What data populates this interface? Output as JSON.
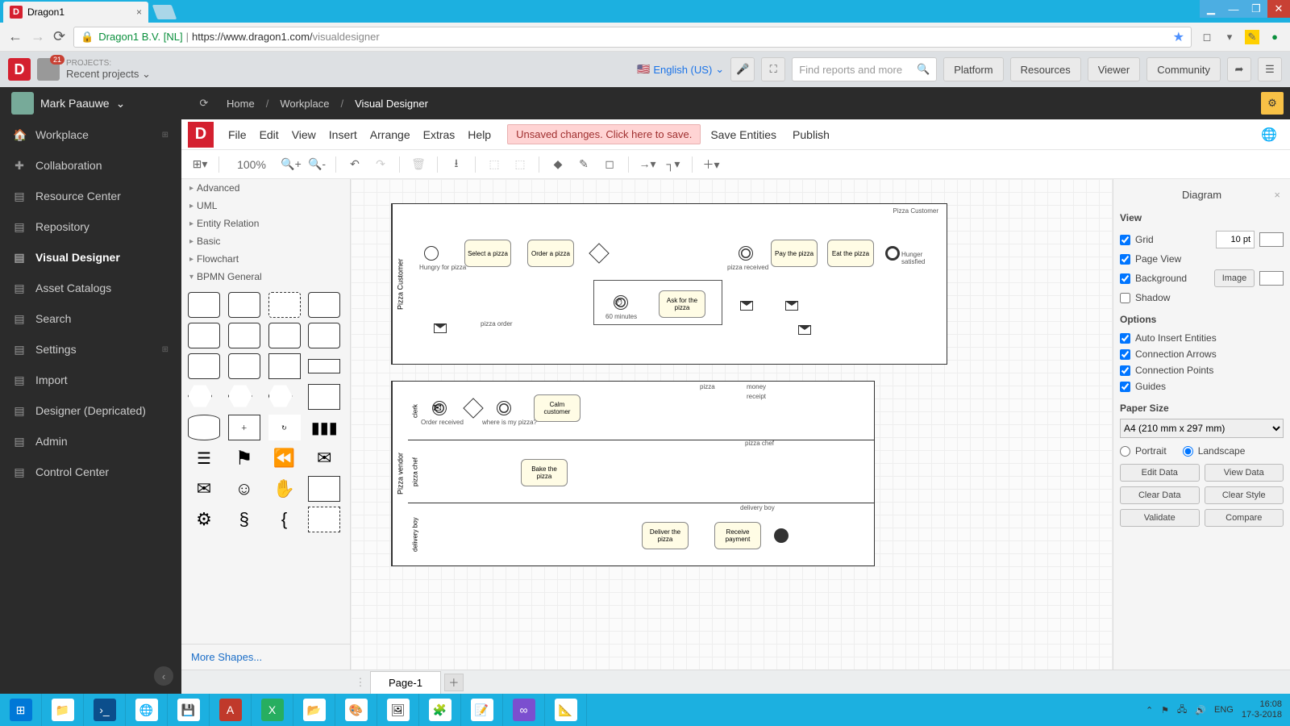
{
  "browser": {
    "tab_title": "Dragon1",
    "address_host": "Dragon1 B.V. [NL]",
    "address_sep": " | ",
    "address_url_base": "https://www.dragon1.com/",
    "address_url_path": "visualdesigner"
  },
  "win": {
    "min": "—",
    "max": "❐",
    "close": "✕"
  },
  "header": {
    "badge": "21",
    "projects_label": "PROJECTS:",
    "recent": "Recent projects",
    "language": "English (US)",
    "search_placeholder": "Find reports and more",
    "buttons": {
      "platform": "Platform",
      "resources": "Resources",
      "viewer": "Viewer",
      "community": "Community"
    }
  },
  "userbar": {
    "name": "Mark Paauwe",
    "crumbs": [
      "Home",
      "Workplace",
      "Visual Designer"
    ]
  },
  "leftnav": [
    {
      "label": "Workplace",
      "icon": "🏠",
      "exp": true
    },
    {
      "label": "Collaboration",
      "icon": "✚"
    },
    {
      "label": "Resource Center",
      "icon": "▤"
    },
    {
      "label": "Repository",
      "icon": "▤"
    },
    {
      "label": "Visual Designer",
      "icon": "▤",
      "active": true
    },
    {
      "label": "Asset Catalogs",
      "icon": "▤"
    },
    {
      "label": "Search",
      "icon": "▤"
    },
    {
      "label": "Settings",
      "icon": "▤",
      "exp": true
    },
    {
      "label": "Import",
      "icon": "▤"
    },
    {
      "label": "Designer (Depricated)",
      "icon": "▤"
    },
    {
      "label": "Admin",
      "icon": "▤"
    },
    {
      "label": "Control Center",
      "icon": "▤"
    }
  ],
  "menus": [
    "File",
    "Edit",
    "View",
    "Insert",
    "Arrange",
    "Extras",
    "Help"
  ],
  "menu_actions": {
    "unsaved": "Unsaved changes. Click here to save.",
    "save_entities": "Save Entities",
    "publish": "Publish"
  },
  "toolbar": {
    "zoom": "100%"
  },
  "shape_cats": [
    "Advanced",
    "UML",
    "Entity Relation",
    "Basic",
    "Flowchart",
    "BPMN General"
  ],
  "more_shapes": "More Shapes...",
  "pager": {
    "page": "Page-1"
  },
  "rightpanel": {
    "title": "Diagram",
    "sec_view": "View",
    "grid": "Grid",
    "grid_val": "10 pt",
    "pageview": "Page View",
    "background": "Background",
    "bg_btn": "Image",
    "shadow": "Shadow",
    "sec_options": "Options",
    "opts": [
      "Auto Insert Entities",
      "Connection Arrows",
      "Connection Points",
      "Guides"
    ],
    "sec_paper": "Paper Size",
    "paper": "A4 (210 mm x 297 mm)",
    "portrait": "Portrait",
    "landscape": "Landscape",
    "btns": [
      "Edit Data",
      "View Data",
      "Clear Data",
      "Clear Style",
      "Validate",
      "Compare"
    ]
  },
  "bpmn": {
    "pool1": "Pizza Customer",
    "pool1_swim": "Pizza Customer",
    "pool2": "Pizza vendor",
    "lane2a": "clerk",
    "lane2b": "pizza chef",
    "lane2c": "delivery boy",
    "t_select": "Select a pizza",
    "t_order": "Order a pizza",
    "t_ask": "Ask for the pizza",
    "t_pay": "Pay the pizza",
    "t_eat": "Eat the pizza",
    "t_calm": "Calm customer",
    "t_bake": "Bake the pizza",
    "t_deliver": "Deliver the pizza",
    "t_receive": "Receive payment",
    "l_hungry": "Hungry for pizza",
    "l_pizzaorder": "pizza order",
    "l_60min": "60 minutes",
    "l_received": "pizza received",
    "l_sat": "Hunger satisfied",
    "l_orderrec": "Order received",
    "l_where": "where is my pizza?",
    "l_pizza": "pizza",
    "l_money": "money",
    "l_receipt": "receipt"
  },
  "taskbar": {
    "lang": "ENG",
    "time": "16:08",
    "date": "17-3-2018"
  }
}
